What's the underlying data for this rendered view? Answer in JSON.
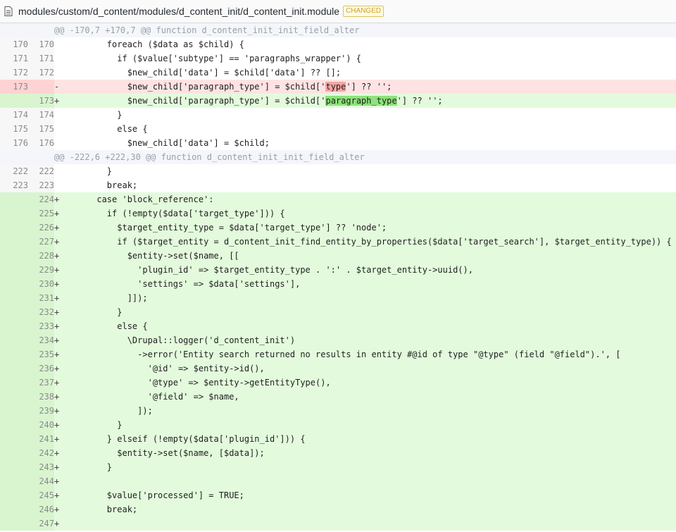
{
  "file": {
    "path": "modules/custom/d_content/modules/d_content_init/d_content_init.module",
    "badge": "CHANGED"
  },
  "diff": {
    "rows": [
      {
        "type": "hunk",
        "old": "",
        "new": "",
        "sign": "",
        "code": "@@ -170,7 +170,7 @@ function d_content_init_init_field_alter"
      },
      {
        "type": "ctx",
        "old": "170",
        "new": "170",
        "sign": "",
        "code": "        foreach ($data as $child) {"
      },
      {
        "type": "ctx",
        "old": "171",
        "new": "171",
        "sign": "",
        "code": "          if ($value['subtype'] == 'paragraphs_wrapper') {"
      },
      {
        "type": "ctx",
        "old": "172",
        "new": "172",
        "sign": "",
        "code": "            $new_child['data'] = $child['data'] ?? [];"
      },
      {
        "type": "del",
        "old": "173",
        "new": "",
        "sign": "-",
        "code_pre": "            $new_child['paragraph_type'] = $child['",
        "code_hl": "type",
        "code_post": "'] ?? '';"
      },
      {
        "type": "add",
        "old": "",
        "new": "173",
        "sign": "+",
        "code_pre": "            $new_child['paragraph_type'] = $child['",
        "code_hl": "paragraph_type",
        "code_post": "'] ?? '';"
      },
      {
        "type": "ctx",
        "old": "174",
        "new": "174",
        "sign": "",
        "code": "          }"
      },
      {
        "type": "ctx",
        "old": "175",
        "new": "175",
        "sign": "",
        "code": "          else {"
      },
      {
        "type": "ctx",
        "old": "176",
        "new": "176",
        "sign": "",
        "code": "            $new_child['data'] = $child;"
      },
      {
        "type": "hunk",
        "old": "",
        "new": "",
        "sign": "",
        "code": "@@ -222,6 +222,30 @@ function d_content_init_init_field_alter"
      },
      {
        "type": "ctx",
        "old": "222",
        "new": "222",
        "sign": "",
        "code": "        }"
      },
      {
        "type": "ctx",
        "old": "223",
        "new": "223",
        "sign": "",
        "code": "        break;"
      },
      {
        "type": "add",
        "old": "",
        "new": "224",
        "sign": "+",
        "code": "      case 'block_reference':"
      },
      {
        "type": "add",
        "old": "",
        "new": "225",
        "sign": "+",
        "code": "        if (!empty($data['target_type'])) {"
      },
      {
        "type": "add",
        "old": "",
        "new": "226",
        "sign": "+",
        "code": "          $target_entity_type = $data['target_type'] ?? 'node';"
      },
      {
        "type": "add",
        "old": "",
        "new": "227",
        "sign": "+",
        "code": "          if ($target_entity = d_content_init_find_entity_by_properties($data['target_search'], $target_entity_type)) {"
      },
      {
        "type": "add",
        "old": "",
        "new": "228",
        "sign": "+",
        "code": "            $entity->set($name, [["
      },
      {
        "type": "add",
        "old": "",
        "new": "229",
        "sign": "+",
        "code": "              'plugin_id' => $target_entity_type . ':' . $target_entity->uuid(),"
      },
      {
        "type": "add",
        "old": "",
        "new": "230",
        "sign": "+",
        "code": "              'settings' => $data['settings'],"
      },
      {
        "type": "add",
        "old": "",
        "new": "231",
        "sign": "+",
        "code": "            ]]);"
      },
      {
        "type": "add",
        "old": "",
        "new": "232",
        "sign": "+",
        "code": "          }"
      },
      {
        "type": "add",
        "old": "",
        "new": "233",
        "sign": "+",
        "code": "          else {"
      },
      {
        "type": "add",
        "old": "",
        "new": "234",
        "sign": "+",
        "code": "            \\Drupal::logger('d_content_init')"
      },
      {
        "type": "add",
        "old": "",
        "new": "235",
        "sign": "+",
        "code": "              ->error('Entity search returned no results in entity #@id of type \"@type\" (field \"@field\").', ["
      },
      {
        "type": "add",
        "old": "",
        "new": "236",
        "sign": "+",
        "code": "                '@id' => $entity->id(),"
      },
      {
        "type": "add",
        "old": "",
        "new": "237",
        "sign": "+",
        "code": "                '@type' => $entity->getEntityType(),"
      },
      {
        "type": "add",
        "old": "",
        "new": "238",
        "sign": "+",
        "code": "                '@field' => $name,"
      },
      {
        "type": "add",
        "old": "",
        "new": "239",
        "sign": "+",
        "code": "              ]);"
      },
      {
        "type": "add",
        "old": "",
        "new": "240",
        "sign": "+",
        "code": "          }"
      },
      {
        "type": "add",
        "old": "",
        "new": "241",
        "sign": "+",
        "code": "        } elseif (!empty($data['plugin_id'])) {"
      },
      {
        "type": "add",
        "old": "",
        "new": "242",
        "sign": "+",
        "code": "          $entity->set($name, [$data]);"
      },
      {
        "type": "add",
        "old": "",
        "new": "243",
        "sign": "+",
        "code": "        }"
      },
      {
        "type": "add",
        "old": "",
        "new": "244",
        "sign": "+",
        "code": ""
      },
      {
        "type": "add",
        "old": "",
        "new": "245",
        "sign": "+",
        "code": "        $value['processed'] = TRUE;"
      },
      {
        "type": "add",
        "old": "",
        "new": "246",
        "sign": "+",
        "code": "        break;"
      },
      {
        "type": "add",
        "old": "",
        "new": "247",
        "sign": "+",
        "code": ""
      }
    ]
  }
}
